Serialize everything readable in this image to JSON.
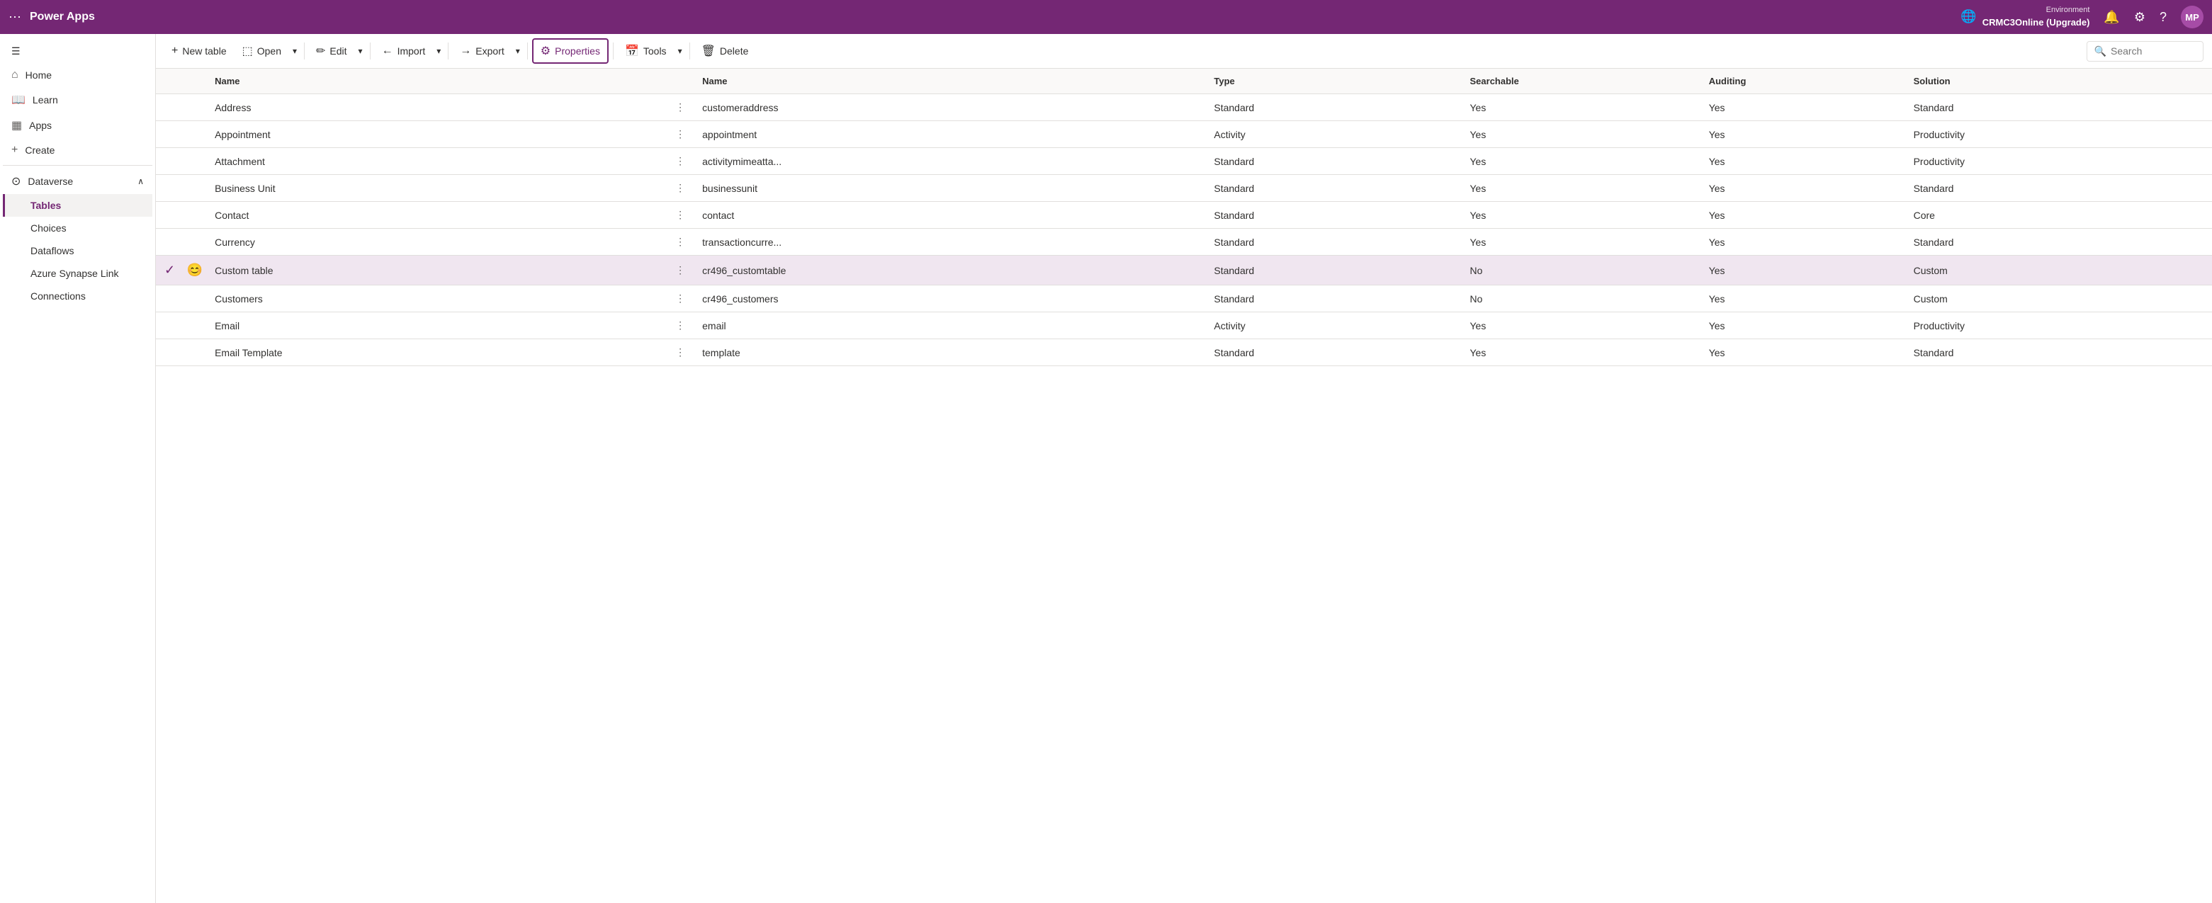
{
  "topNav": {
    "gridIcon": "⊞",
    "appTitle": "Power Apps",
    "environment": {
      "label": "Environment",
      "name": "CRMC3Online (Upgrade)"
    },
    "bellIcon": "🔔",
    "gearIcon": "⚙",
    "helpIcon": "?",
    "avatar": "MP"
  },
  "sidebar": {
    "hamburgerIcon": "☰",
    "items": [
      {
        "label": "Home",
        "icon": "⌂",
        "active": false
      },
      {
        "label": "Learn",
        "icon": "📖",
        "active": false
      },
      {
        "label": "Apps",
        "icon": "▦",
        "active": false
      },
      {
        "label": "Create",
        "icon": "+",
        "active": false
      }
    ],
    "dataverse": {
      "label": "Dataverse",
      "icon": "⊙",
      "chevron": "∧",
      "subItems": [
        {
          "label": "Tables",
          "active": true
        },
        {
          "label": "Choices",
          "active": false
        },
        {
          "label": "Dataflows",
          "active": false
        },
        {
          "label": "Azure Synapse Link",
          "active": false
        },
        {
          "label": "Connections",
          "active": false
        }
      ]
    }
  },
  "toolbar": {
    "newTableLabel": "New table",
    "openLabel": "Open",
    "editLabel": "Edit",
    "importLabel": "Import",
    "exportLabel": "Export",
    "propertiesLabel": "Properties",
    "toolsLabel": "Tools",
    "deleteLabel": "Delete",
    "searchPlaceholder": "Search"
  },
  "table": {
    "columns": [
      {
        "id": "check",
        "label": ""
      },
      {
        "id": "icon",
        "label": ""
      },
      {
        "id": "name",
        "label": "Name"
      },
      {
        "id": "dots",
        "label": ""
      },
      {
        "id": "nameval",
        "label": "Name"
      },
      {
        "id": "type",
        "label": "Type"
      },
      {
        "id": "searchable",
        "label": "Searchable"
      },
      {
        "id": "auditing",
        "label": "Auditing"
      },
      {
        "id": "solution",
        "label": "Solution"
      }
    ],
    "rows": [
      {
        "name": "Address",
        "nameVal": "customeraddress",
        "type": "Standard",
        "searchable": "Yes",
        "auditing": "Yes",
        "solution": "Standard",
        "selected": false,
        "checkIcon": "",
        "emoji": ""
      },
      {
        "name": "Appointment",
        "nameVal": "appointment",
        "type": "Activity",
        "searchable": "Yes",
        "auditing": "Yes",
        "solution": "Productivity",
        "selected": false,
        "checkIcon": "",
        "emoji": ""
      },
      {
        "name": "Attachment",
        "nameVal": "activitymimeatta...",
        "type": "Standard",
        "searchable": "Yes",
        "auditing": "Yes",
        "solution": "Productivity",
        "selected": false,
        "checkIcon": "",
        "emoji": ""
      },
      {
        "name": "Business Unit",
        "nameVal": "businessunit",
        "type": "Standard",
        "searchable": "Yes",
        "auditing": "Yes",
        "solution": "Standard",
        "selected": false,
        "checkIcon": "",
        "emoji": ""
      },
      {
        "name": "Contact",
        "nameVal": "contact",
        "type": "Standard",
        "searchable": "Yes",
        "auditing": "Yes",
        "solution": "Core",
        "selected": false,
        "checkIcon": "",
        "emoji": ""
      },
      {
        "name": "Currency",
        "nameVal": "transactioncurre...",
        "type": "Standard",
        "searchable": "Yes",
        "auditing": "Yes",
        "solution": "Standard",
        "selected": false,
        "checkIcon": "",
        "emoji": ""
      },
      {
        "name": "Custom table",
        "nameVal": "cr496_customtable",
        "type": "Standard",
        "searchable": "No",
        "auditing": "Yes",
        "solution": "Custom",
        "selected": true,
        "checkIcon": "✓",
        "emoji": "😊"
      },
      {
        "name": "Customers",
        "nameVal": "cr496_customers",
        "type": "Standard",
        "searchable": "No",
        "auditing": "Yes",
        "solution": "Custom",
        "selected": false,
        "checkIcon": "",
        "emoji": ""
      },
      {
        "name": "Email",
        "nameVal": "email",
        "type": "Activity",
        "searchable": "Yes",
        "auditing": "Yes",
        "solution": "Productivity",
        "selected": false,
        "checkIcon": "",
        "emoji": ""
      },
      {
        "name": "Email Template",
        "nameVal": "template",
        "type": "Standard",
        "searchable": "Yes",
        "auditing": "Yes",
        "solution": "Standard",
        "selected": false,
        "checkIcon": "",
        "emoji": ""
      }
    ]
  }
}
